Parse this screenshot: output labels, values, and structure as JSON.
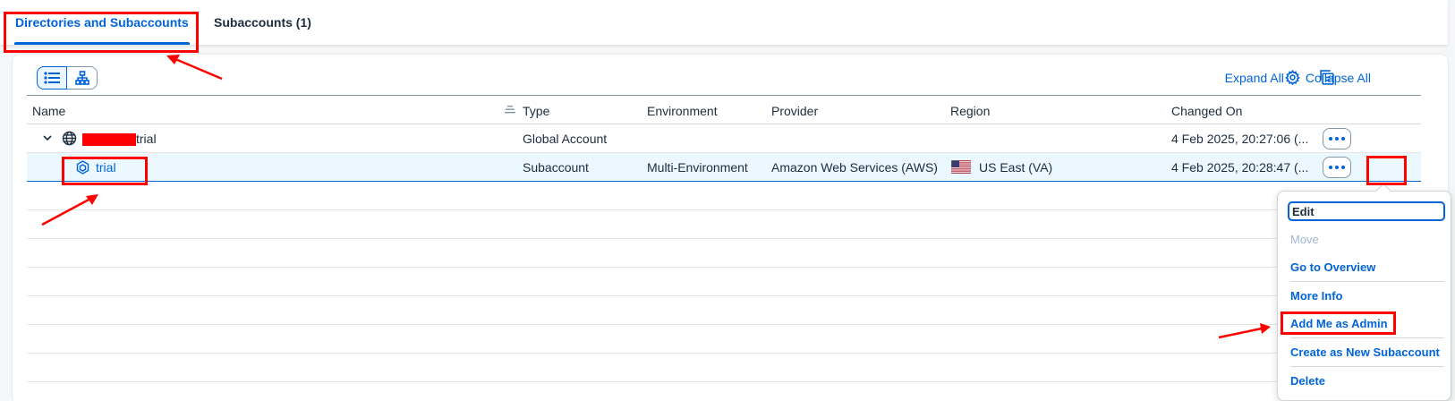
{
  "tabs": [
    {
      "label": "Directories and Subaccounts",
      "active": true
    },
    {
      "label": "Subaccounts (1)",
      "active": false
    }
  ],
  "toolbar": {
    "expand_all": "Expand All",
    "collapse_all": "Collapse All",
    "icons": [
      "list-view-icon",
      "hierarchy-view-icon",
      "settings-icon",
      "export-icon"
    ]
  },
  "table": {
    "columns": [
      "Name",
      "Type",
      "Environment",
      "Provider",
      "Region",
      "Changed On"
    ],
    "rows": [
      {
        "name": "trial",
        "type": "Global Account",
        "environment": "",
        "provider": "",
        "region": "",
        "changed_on": "4 Feb 2025, 20:27:06 (..."
      },
      {
        "name": "trial",
        "type": "Subaccount",
        "environment": "Multi-Environment",
        "provider": "Amazon Web Services (AWS)",
        "region": "US East (VA)",
        "changed_on": "4 Feb 2025, 20:28:47 (..."
      }
    ]
  },
  "menu": {
    "items": [
      {
        "label": "Edit",
        "enabled": true
      },
      {
        "label": "Move",
        "enabled": false
      },
      {
        "label": "Go to Overview",
        "enabled": true
      },
      {
        "label": "More Info",
        "enabled": true
      },
      {
        "label": "Add Me as Admin",
        "enabled": true
      },
      {
        "label": "Create as New Subaccount",
        "enabled": true
      },
      {
        "label": "Delete",
        "enabled": true
      }
    ]
  },
  "colors": {
    "accent": "#0064d9",
    "annotation": "#ff0000",
    "selected_row": "#ebf8ff"
  }
}
